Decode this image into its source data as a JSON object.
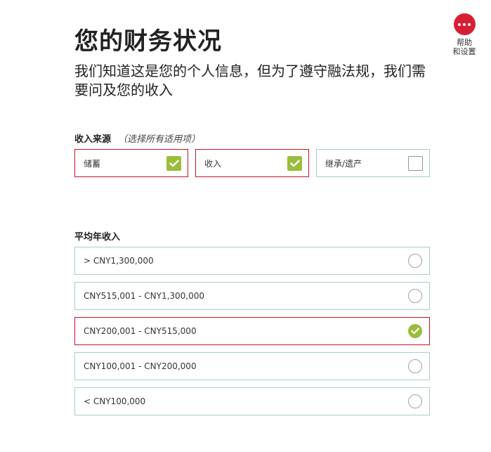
{
  "help": {
    "label_line1": "帮助",
    "label_line2": "和设置",
    "icon": "more-dots-icon",
    "color": "#d61f35"
  },
  "header": {
    "title": "您的财务状况",
    "subtitle": "我们知道这是您的个人信息，但为了遵守融法规，我们需要问及您的收入"
  },
  "income_source": {
    "label": "收入来源",
    "hint": "（选择所有适用项）",
    "options": [
      {
        "label": "储蓄",
        "checked": true
      },
      {
        "label": "收入",
        "checked": true
      },
      {
        "label": "继承/遗产",
        "checked": false
      }
    ]
  },
  "annual_income": {
    "label": "平均年收入",
    "options": [
      {
        "label": "> CNY1,300,000",
        "selected": false
      },
      {
        "label": "CNY515,001 - CNY1,300,000",
        "selected": false
      },
      {
        "label": "CNY200,001 - CNY515,000",
        "selected": true
      },
      {
        "label": "CNY100,001 - CNY200,000",
        "selected": false
      },
      {
        "label": "< CNY100,000",
        "selected": false
      }
    ]
  },
  "colors": {
    "selected_border": "#c8102e",
    "default_border": "#a7cfc6",
    "check_green": "#9bbd3c"
  }
}
